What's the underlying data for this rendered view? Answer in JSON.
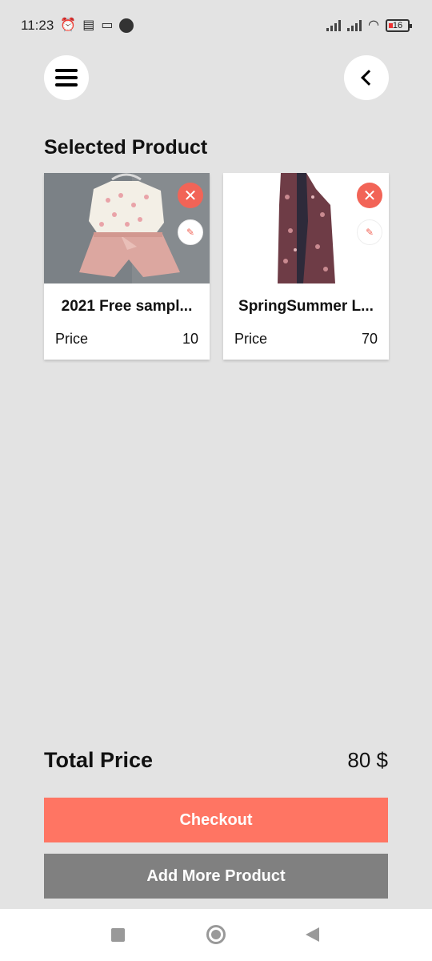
{
  "status_bar": {
    "time": "11:23",
    "battery": "16"
  },
  "header": {
    "menu_icon": "hamburger-menu-icon",
    "back_icon": "chevron-left-icon"
  },
  "section_title": "Selected Product",
  "products": [
    {
      "name": "2021 Free sampl...",
      "price_label": "Price",
      "price": "10"
    },
    {
      "name": "SpringSummer L...",
      "price_label": "Price",
      "price": "70"
    }
  ],
  "summary": {
    "total_label": "Total Price",
    "total_value": "80 $"
  },
  "actions": {
    "checkout_label": "Checkout",
    "add_more_label": "Add More Product"
  },
  "colors": {
    "accent": "#ff7563",
    "remove": "#f26457",
    "secondary_button": "#808080",
    "background": "#e3e3e3"
  }
}
